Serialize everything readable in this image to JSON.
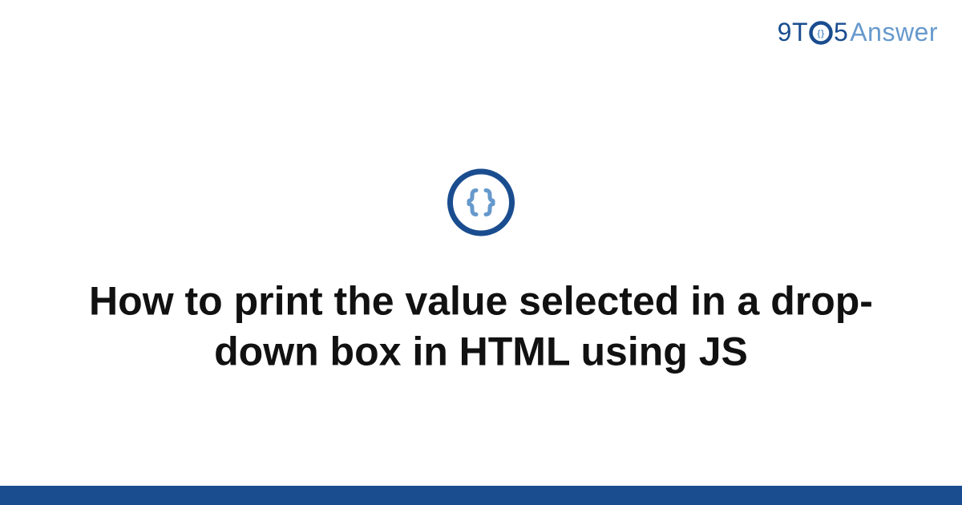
{
  "logo": {
    "part1": "9T",
    "part2": "5",
    "part3": "Answer"
  },
  "icon": {
    "name": "code-braces-icon"
  },
  "title": "How to print the value selected in a drop-down box in HTML using JS",
  "colors": {
    "brand_dark": "#1a4d8f",
    "brand_light": "#6699cc"
  }
}
